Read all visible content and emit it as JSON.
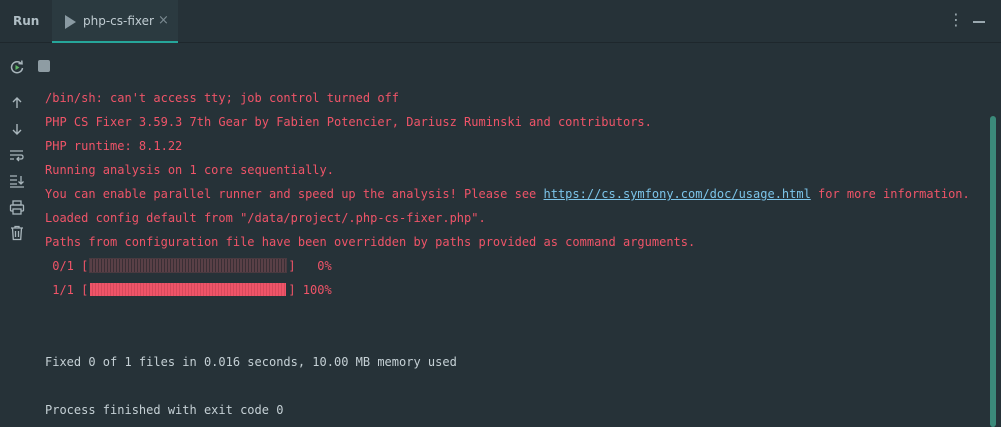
{
  "header": {
    "run_label": "Run",
    "tab_label": "php-cs-fixer",
    "close_glyph": "×",
    "more_glyph": "⋮"
  },
  "toolbar": {
    "icons": [
      "rerun-icon",
      "stop-icon",
      "scroll-up-icon",
      "scroll-down-icon",
      "soft-wrap-icon",
      "scroll-to-end-icon",
      "print-icon",
      "clear-icon"
    ]
  },
  "console": {
    "lines": [
      "/bin/sh: can't access tty; job control turned off",
      "PHP CS Fixer 3.59.3 7th Gear by Fabien Potencier, Dariusz Ruminski and contributors.",
      "PHP runtime: 8.1.22",
      "Running analysis on 1 core sequentially.",
      "You can enable parallel runner and speed up the analysis! Please see ",
      "Loaded config default from \"/data/project/.php-cs-fixer.php\".",
      "Paths from configuration file have been overridden by paths provided as command arguments."
    ],
    "link_text": "https://cs.symfony.com/doc/usage.html",
    "link_suffix": " for more information.",
    "progress": [
      {
        "count": " 0/1 [",
        "end": "]   0%",
        "fraction": 0
      },
      {
        "count": " 1/1 [",
        "end": "] 100%",
        "fraction": 1
      }
    ],
    "summary": "Fixed 0 of 1 files in 0.016 seconds, 10.00 MB memory used",
    "exit": "Process finished with exit code 0"
  },
  "colors": {
    "background": "#263238",
    "stderr": "#ef5468",
    "stdout": "#c5d0d5",
    "link": "#7cc4e9",
    "accent": "#26a69a"
  }
}
